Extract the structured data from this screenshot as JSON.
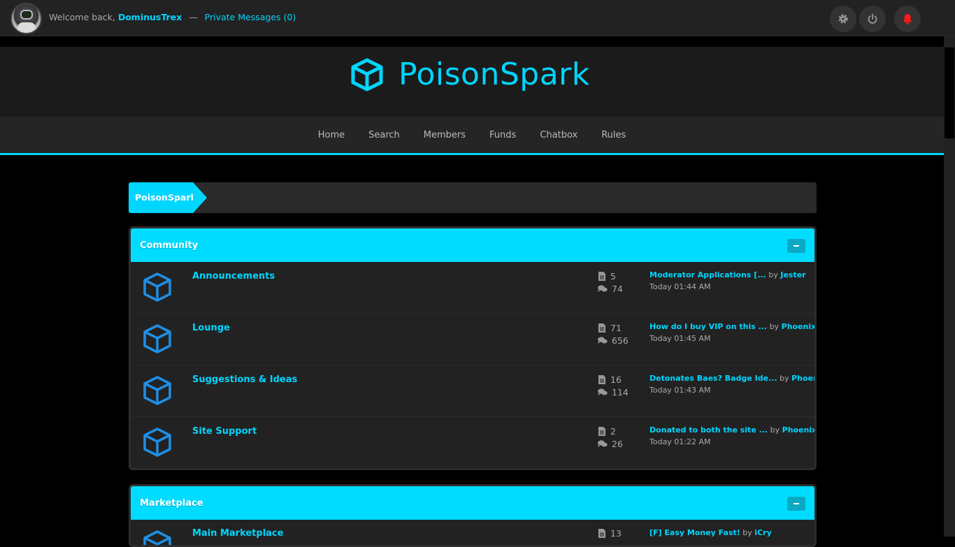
{
  "topbar": {
    "welcome": "Welcome back,",
    "username": "DominusTrex",
    "separator": "—",
    "private_messages": "Private Messages (0)"
  },
  "site": {
    "name": "PoisonSpark"
  },
  "nav": [
    "Home",
    "Search",
    "Members",
    "Funds",
    "Chatbox",
    "Rules"
  ],
  "breadcrumb": {
    "root": "PoisonSpark"
  },
  "categories": [
    {
      "title": "Community",
      "forums": [
        {
          "name": "Announcements",
          "threads": "5",
          "posts": "74",
          "last_title": "Moderator Applications [...",
          "by": "by",
          "last_user": "Jester",
          "last_time": "Today 01:44 AM"
        },
        {
          "name": "Lounge",
          "threads": "71",
          "posts": "656",
          "last_title": "How do I buy VIP on this ...",
          "by": "by",
          "last_user": "Phoenix",
          "last_time": "Today 01:45 AM"
        },
        {
          "name": "Suggestions & Ideas",
          "threads": "16",
          "posts": "114",
          "last_title": "Detonates Baes? Badge Ide...",
          "by": "by",
          "last_user": "Phoenix",
          "last_time": "Today 01:43 AM"
        },
        {
          "name": "Site Support",
          "threads": "2",
          "posts": "26",
          "last_title": "Donated to both the site ...",
          "by": "by",
          "last_user": "Phoenix",
          "last_time": "Today 01:22 AM"
        }
      ]
    },
    {
      "title": "Marketplace",
      "forums": [
        {
          "name": "Main Marketplace",
          "threads": "13",
          "posts": "",
          "last_title": "[F] Easy Money Fast!",
          "by": "by",
          "last_user": "iCry",
          "last_time": ""
        }
      ]
    }
  ],
  "colors": {
    "accent": "#00d6ff",
    "notification": "#ff1a1a",
    "forum_icon": "#1e8fe6"
  },
  "icons": {
    "settings": "gear-icon",
    "logout": "power-icon",
    "alerts": "bell-icon",
    "forum": "cube-icon",
    "threads": "document-icon",
    "posts": "comments-icon"
  }
}
